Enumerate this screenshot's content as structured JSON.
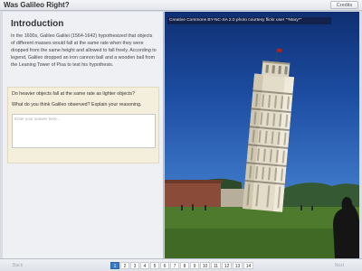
{
  "header": {
    "title": "Was Galileo Right?",
    "credits_label": "Credits"
  },
  "left": {
    "heading": "Introduction",
    "body": "In the 1600s, Galileo Galilei (1564-1642) hypothesized that objects of different masses would fall at the same rate when they were dropped from the same height and allowed to fall freely. According to legend, Galileo dropped an iron cannon ball and a wooden ball from the Leaning Tower of Pisa to test his hypothesis.",
    "question_1": "Do heavier objects fall at the same rate as lighter objects?",
    "question_2": "What do you think Galileo observed? Explain your reasoning.",
    "answer_placeholder": "Enter your answer here...",
    "answer_value": ""
  },
  "photo": {
    "caption": "Creative Commons BY-NC-SA 2.0 photo courtesy flickr user \"*Mary*\"",
    "subject": "leaning-tower-of-pisa"
  },
  "footer": {
    "back_label": "Back",
    "next_label": "Next",
    "current_page": 1,
    "pages": [
      "1",
      "2",
      "3",
      "4",
      "5",
      "6",
      "7",
      "8",
      "9",
      "10",
      "11",
      "12",
      "13",
      "14"
    ]
  },
  "colors": {
    "accent": "#3979c6",
    "panel": "#eef0f4",
    "question_bg": "#f4efdc"
  }
}
